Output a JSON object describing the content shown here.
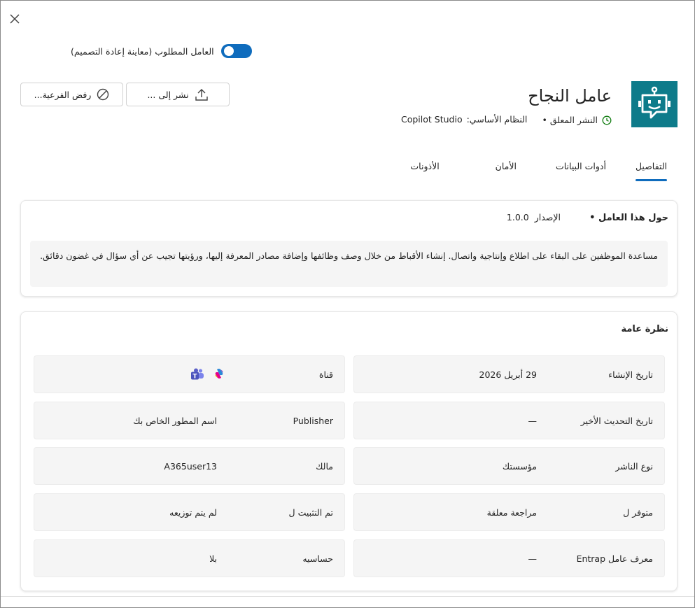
{
  "dialog": {
    "close_label": "✕"
  },
  "toggle": {
    "label": "العامل المطلوب (معاينة إعادة التصميم)",
    "on": true
  },
  "actions": {
    "publish_label": "نشر إلى ...",
    "reject_label": "رفض الفرعية..."
  },
  "agent": {
    "name": "عامل النجاح",
    "status": "النشر المعلق •",
    "platform_key": "النظام الأساسي:",
    "platform_value": "Copilot Studio",
    "logo_bg": "#0e7b8a"
  },
  "tabs": [
    {
      "label": "التفاصيل",
      "active": true
    },
    {
      "label": "أدوات البيانات",
      "active": false
    },
    {
      "label": "الأمان",
      "active": false
    },
    {
      "label": "الأذونات",
      "active": false
    }
  ],
  "about": {
    "title": "حول هذا العامل •",
    "version_key": "الإصدار",
    "version_value": "1.0.0",
    "description": "مساعدة الموظفين على البقاء على اطلاع وإنتاجية واتصال. إنشاء الأقباط من خلال وصف وظائفها وإضافة مصادر المعرفة إليها، ورؤيتها تجيب عن أي سؤال في غضون دقائق."
  },
  "overview": {
    "title": "نظرة عامة",
    "right_column": [
      {
        "key": "تاريخ الإنشاء",
        "value": "29 أبريل 2026"
      },
      {
        "key": "تاريخ التحديث الأخير",
        "value": "—"
      },
      {
        "key": "نوع الناشر",
        "value": "مؤسستك"
      },
      {
        "key": "متوفر ل",
        "value": "مراجعة معلقة"
      },
      {
        "key": "معرف عامل Entrap",
        "value": "—"
      }
    ],
    "left_column": [
      {
        "key": "قناة",
        "value": "",
        "icons": [
          "copilot-icon",
          "teams-icon"
        ]
      },
      {
        "key": "Publisher",
        "value": "اسم المطور الخاص بك"
      },
      {
        "key": "مالك",
        "value": "A365user13"
      },
      {
        "key": "تم التثبيت ل",
        "value": "لم يتم توزيعه"
      },
      {
        "key": "حساسيه",
        "value": "بلا"
      }
    ]
  },
  "colors": {
    "accent": "#0f6cbd",
    "status_green": "#107c10",
    "teams_purple": "#5b5fc7"
  }
}
